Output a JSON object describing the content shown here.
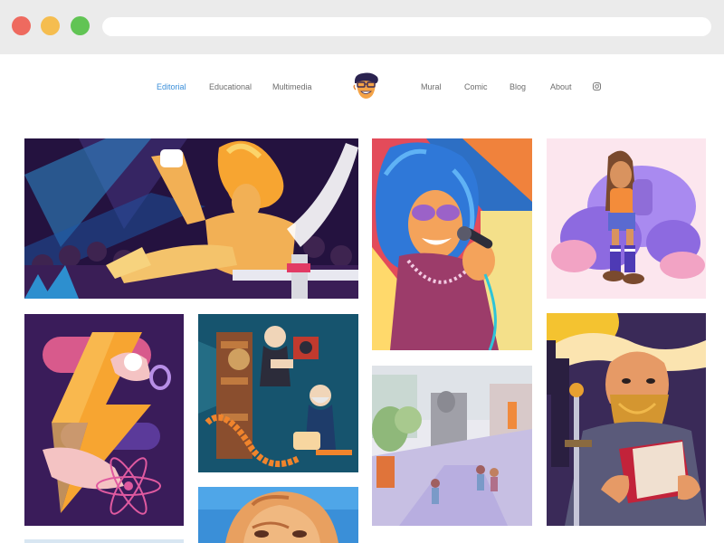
{
  "nav": {
    "left": [
      {
        "label": "Editorial",
        "active": true
      },
      {
        "label": "Educational",
        "active": false
      },
      {
        "label": "Multimedia",
        "active": false
      }
    ],
    "right": [
      {
        "label": "Mural",
        "active": false
      },
      {
        "label": "Comic",
        "active": false
      },
      {
        "label": "Blog",
        "active": false
      },
      {
        "label": "About",
        "active": false
      }
    ],
    "logo_icon": "character-logo-icon",
    "social_icon": "instagram-icon"
  },
  "colors": {
    "active_link": "#3b8fd9",
    "link": "#6d6d6d",
    "chrome": "#ebebeb"
  },
  "gallery": [
    {
      "name": "gymnast-illustration"
    },
    {
      "name": "singer-with-microphone-illustration"
    },
    {
      "name": "girl-with-backpack-illustration"
    },
    {
      "name": "lightning-atom-illustration"
    },
    {
      "name": "film-inventors-illustration"
    },
    {
      "name": "street-sketch-illustration"
    },
    {
      "name": "bearded-man-with-book-illustration"
    },
    {
      "name": "portrait-face-illustration"
    }
  ]
}
